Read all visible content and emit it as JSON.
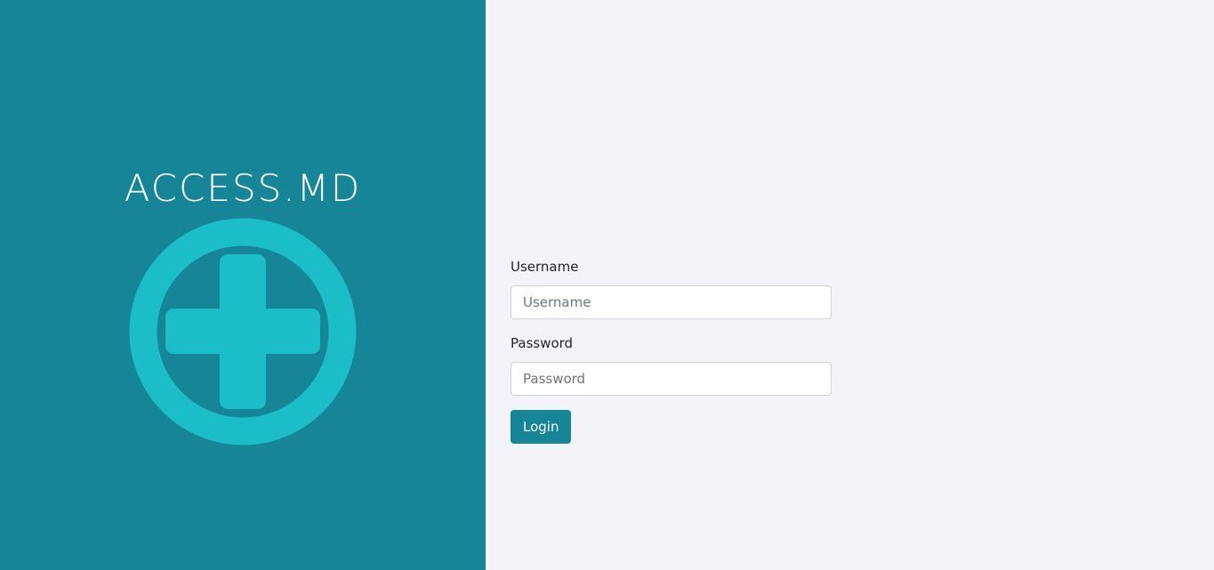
{
  "brand": {
    "title": "ACCESS.MD",
    "logo_icon": "medical-cross-icon",
    "panel_color": "#168597",
    "logo_color": "#1bbdc6"
  },
  "login": {
    "username_label": "Username",
    "username_placeholder": "Username",
    "username_value": "",
    "password_label": "Password",
    "password_placeholder": "Password",
    "password_value": "",
    "submit_label": "Login",
    "button_color": "#168597"
  }
}
